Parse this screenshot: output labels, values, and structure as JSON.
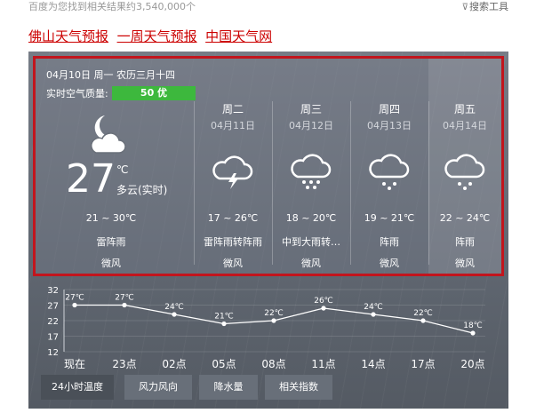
{
  "results": {
    "count_text": "百度为您找到相关结果约3,540,000个",
    "tools_label": "搜索工具",
    "tools_icon": "funnel-icon"
  },
  "result_title": {
    "links": [
      "佛山天气预报",
      "一周天气预报",
      "中国天气网"
    ],
    "color": "#cc0000"
  },
  "weather": {
    "date_line": "04月10日 周一 农历三月十四",
    "aqi_label": "实时空气质量:",
    "aqi_value": "50 优",
    "aqi_color": "#3db83d",
    "today": {
      "icon": "moon-cloud-icon",
      "temp": "27",
      "unit": "℃",
      "condition": "多云(实时)",
      "range": "21 ~ 30℃",
      "desc": "雷阵雨",
      "wind": "微风"
    },
    "days": [
      {
        "name": "周二",
        "date": "04月11日",
        "icon": "thunder-cloud-icon",
        "range": "17 ~ 26℃",
        "desc": "雷阵雨转阵雨",
        "wind": "微风"
      },
      {
        "name": "周三",
        "date": "04月12日",
        "icon": "rain-cloud-icon",
        "range": "18 ~ 20℃",
        "desc": "中到大雨转…",
        "wind": "微风"
      },
      {
        "name": "周四",
        "date": "04月13日",
        "icon": "rain-cloud-icon",
        "range": "19 ~ 21℃",
        "desc": "阵雨",
        "wind": "微风"
      },
      {
        "name": "周五",
        "date": "04月14日",
        "icon": "rain-cloud-icon",
        "range": "22 ~ 24℃",
        "desc": "阵雨",
        "wind": "微风"
      }
    ],
    "frame_color": "#c2151d"
  },
  "chart_data": {
    "type": "line",
    "categories": [
      "现在",
      "23点",
      "02点",
      "05点",
      "08点",
      "11点",
      "14点",
      "17点",
      "20点"
    ],
    "values": [
      27,
      27,
      24,
      21,
      22,
      26,
      24,
      22,
      18
    ],
    "point_labels": [
      "27℃",
      "27℃",
      "24℃",
      "21℃",
      "22℃",
      "26℃",
      "24℃",
      "22℃",
      "18℃"
    ],
    "yticks": [
      32,
      27,
      22,
      17,
      12
    ],
    "ylim": [
      12,
      32
    ],
    "grid": true
  },
  "tabs": [
    "24小时温度",
    "风力风向",
    "降水量",
    "相关指数"
  ]
}
